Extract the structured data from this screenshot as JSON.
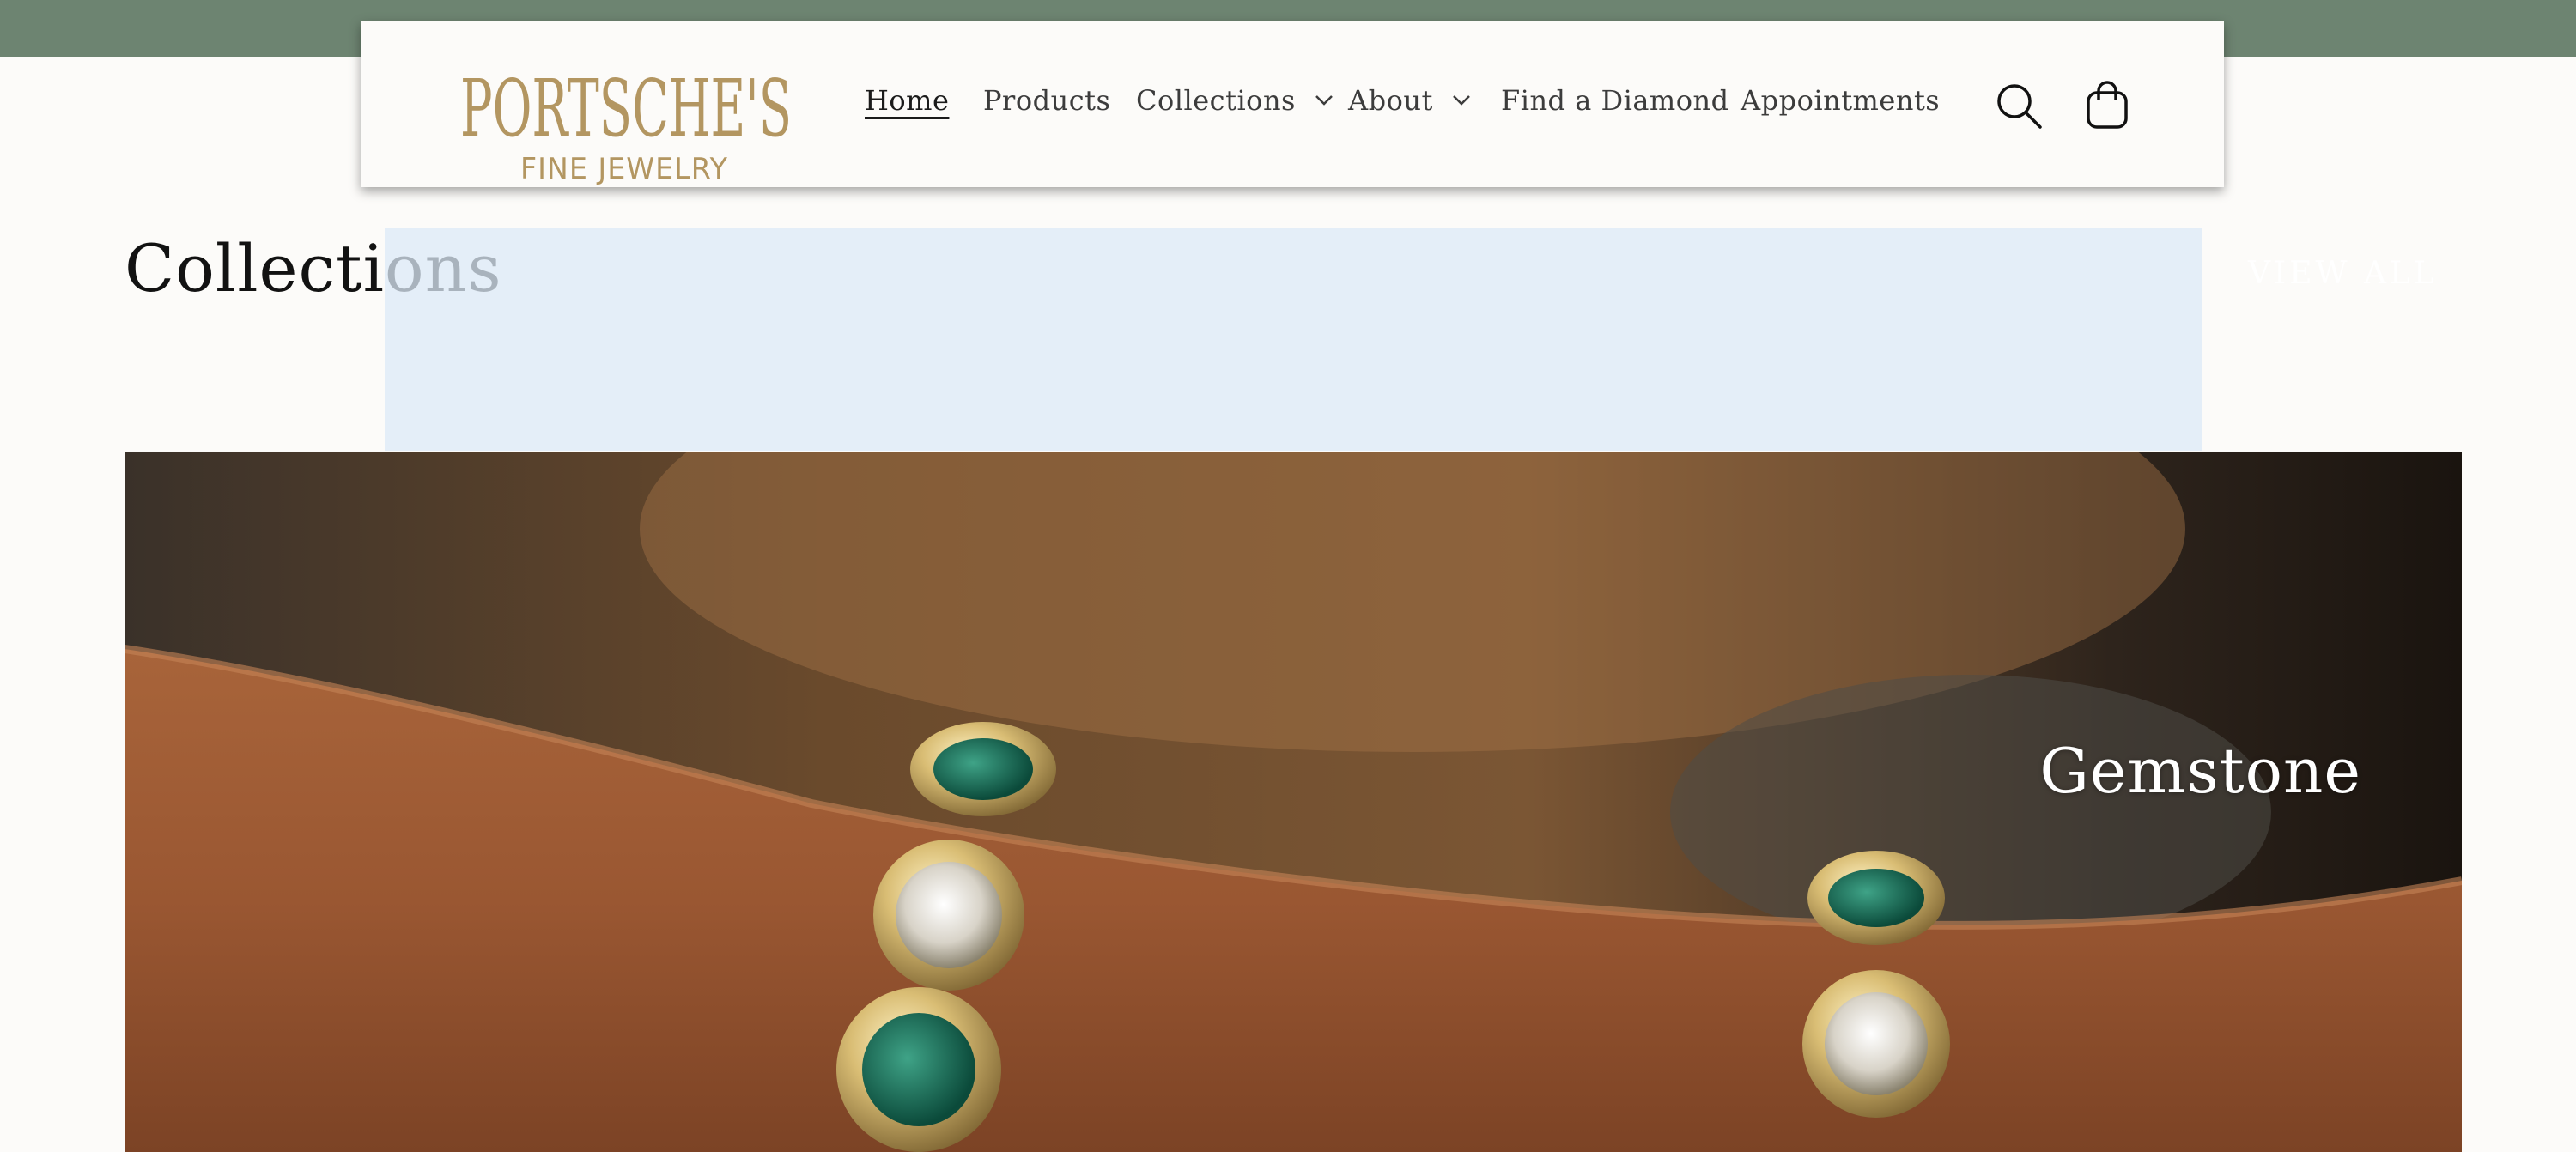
{
  "brand": {
    "logo_main": "PORTSCHE'S",
    "logo_sub": "FINE JEWELRY",
    "logo_color": "#b39661"
  },
  "nav": {
    "items": [
      {
        "label": "Home",
        "active": true
      },
      {
        "label": "Products"
      },
      {
        "label": "Collections",
        "has_dropdown": true
      },
      {
        "label": "About",
        "has_dropdown": true
      },
      {
        "label": "Find a Diamond"
      },
      {
        "label": "Appointments"
      }
    ],
    "search_icon": "search-icon",
    "cart_icon": "cart-icon"
  },
  "collections": {
    "title": "Collections",
    "view_all": "VIEW ALL",
    "featured": {
      "label": "Gemstone"
    }
  },
  "colors": {
    "top_band": "#6d8471",
    "background": "#fcfbf9",
    "accent_gold": "#b39661"
  }
}
